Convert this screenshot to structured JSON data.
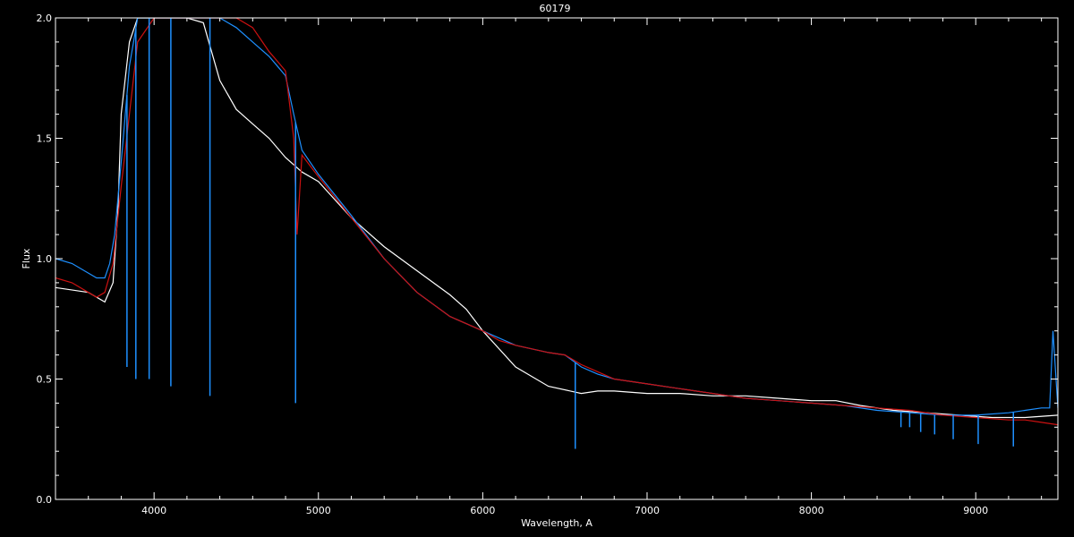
{
  "chart_data": {
    "type": "line",
    "title": "60179",
    "xlabel": "Wavelength, A",
    "ylabel": "Flux",
    "xlim": [
      3400,
      9500
    ],
    "ylim": [
      0.0,
      2.0
    ],
    "x_ticks": [
      4000,
      5000,
      6000,
      7000,
      8000,
      9000
    ],
    "x_tick_labels": [
      "4000",
      "5000",
      "6000",
      "7000",
      "8000",
      "9000"
    ],
    "y_ticks": [
      0.0,
      0.5,
      1.0,
      1.5,
      2.0
    ],
    "y_tick_labels": [
      "0.0",
      "0.5",
      "1.0",
      "1.5",
      "2.0"
    ],
    "grid": false,
    "series": [
      {
        "color": "#ffffff",
        "x": [
          3400,
          3600,
          3700,
          3750,
          3780,
          3800,
          3850,
          3900,
          3950,
          4000,
          4100,
          4200,
          4300,
          4400,
          4500,
          4600,
          4700,
          4800,
          4900,
          5000,
          5200,
          5400,
          5600,
          5800,
          5900,
          6000,
          6200,
          6400,
          6600,
          6700,
          6800,
          7000,
          7200,
          7400,
          7600,
          7800,
          8000,
          8150,
          8300,
          8500,
          8700,
          8900,
          9100,
          9300,
          9500
        ],
        "y": [
          0.88,
          0.86,
          0.82,
          0.9,
          1.2,
          1.6,
          1.9,
          2.0,
          2.0,
          2.0,
          2.0,
          2.0,
          1.98,
          1.74,
          1.62,
          1.56,
          1.5,
          1.42,
          1.36,
          1.32,
          1.17,
          1.05,
          0.95,
          0.85,
          0.79,
          0.7,
          0.55,
          0.47,
          0.44,
          0.45,
          0.45,
          0.44,
          0.44,
          0.43,
          0.43,
          0.42,
          0.41,
          0.41,
          0.39,
          0.37,
          0.36,
          0.35,
          0.34,
          0.34,
          0.35
        ]
      },
      {
        "color": "#1e90ff",
        "x": [
          3400,
          3500,
          3600,
          3650,
          3700,
          3730,
          3760,
          3800,
          3850,
          3900,
          3950,
          4000,
          4100,
          4200,
          4300,
          4400,
          4500,
          4600,
          4700,
          4750,
          4800,
          4850,
          4900,
          5000,
          5200,
          5400,
          5600,
          5800,
          6000,
          6200,
          6400,
          6500,
          6600,
          6700,
          6800,
          7000,
          7200,
          7400,
          7600,
          7800,
          8000,
          8200,
          8400,
          8600,
          8800,
          9000,
          9200,
          9300,
          9400,
          9450,
          9470,
          9500
        ],
        "y": [
          1.0,
          0.98,
          0.94,
          0.92,
          0.92,
          0.98,
          1.1,
          1.4,
          1.8,
          2.0,
          2.0,
          2.0,
          2.0,
          2.0,
          2.0,
          2.0,
          1.96,
          1.9,
          1.84,
          1.8,
          1.76,
          1.6,
          1.45,
          1.35,
          1.18,
          1.0,
          0.86,
          0.76,
          0.7,
          0.64,
          0.61,
          0.6,
          0.55,
          0.52,
          0.5,
          0.48,
          0.46,
          0.44,
          0.42,
          0.41,
          0.4,
          0.39,
          0.37,
          0.36,
          0.35,
          0.35,
          0.36,
          0.37,
          0.38,
          0.38,
          0.7,
          0.38
        ]
      },
      {
        "color": "#cc1111",
        "x": [
          3400,
          3500,
          3600,
          3650,
          3700,
          3750,
          3800,
          3850,
          3900,
          4000,
          4100,
          4200,
          4300,
          4400,
          4500,
          4600,
          4700,
          4750,
          4800,
          4850,
          4870,
          4900,
          5000,
          5200,
          5400,
          5600,
          5800,
          6000,
          6100,
          6200,
          6400,
          6500,
          6600,
          6700,
          6800,
          7000,
          7200,
          7400,
          7600,
          7800,
          8000,
          8200,
          8400,
          8600,
          8800,
          9000,
          9200,
          9300,
          9400,
          9500
        ],
        "y": [
          0.92,
          0.9,
          0.86,
          0.84,
          0.86,
          0.98,
          1.3,
          1.6,
          1.9,
          2.0,
          2.0,
          2.0,
          2.0,
          2.0,
          2.0,
          1.96,
          1.86,
          1.82,
          1.78,
          1.5,
          1.1,
          1.43,
          1.34,
          1.17,
          1.0,
          0.86,
          0.76,
          0.7,
          0.66,
          0.64,
          0.61,
          0.6,
          0.56,
          0.53,
          0.5,
          0.48,
          0.46,
          0.44,
          0.42,
          0.41,
          0.4,
          0.39,
          0.38,
          0.37,
          0.35,
          0.34,
          0.33,
          0.33,
          0.32,
          0.31
        ]
      }
    ],
    "absorption_lines": [
      {
        "wavelength": 3835,
        "depth_to": 0.55
      },
      {
        "wavelength": 3889,
        "depth_to": 0.5
      },
      {
        "wavelength": 3970,
        "depth_to": 0.5
      },
      {
        "wavelength": 4102,
        "depth_to": 0.47
      },
      {
        "wavelength": 4340,
        "depth_to": 0.43
      },
      {
        "wavelength": 4861,
        "depth_to": 0.4
      },
      {
        "wavelength": 6563,
        "depth_to": 0.21
      },
      {
        "wavelength": 8545,
        "depth_to": 0.3
      },
      {
        "wavelength": 8598,
        "depth_to": 0.3
      },
      {
        "wavelength": 8665,
        "depth_to": 0.28
      },
      {
        "wavelength": 8750,
        "depth_to": 0.27
      },
      {
        "wavelength": 8863,
        "depth_to": 0.25
      },
      {
        "wavelength": 9015,
        "depth_to": 0.23
      },
      {
        "wavelength": 9229,
        "depth_to": 0.22
      }
    ]
  }
}
